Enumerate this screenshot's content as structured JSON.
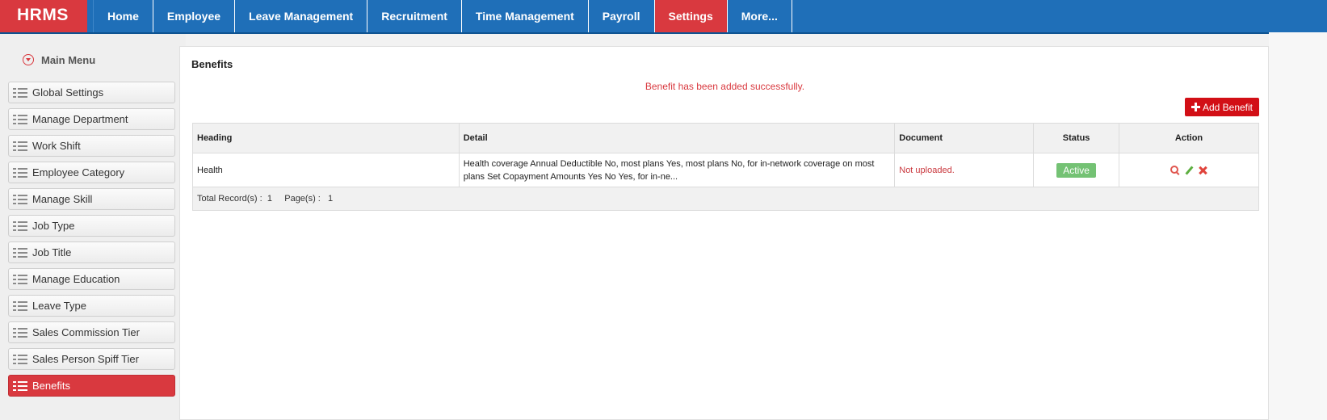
{
  "app": {
    "logo": "HRMS"
  },
  "nav": {
    "items": [
      "Home",
      "Employee",
      "Leave Management",
      "Recruitment",
      "Time Management",
      "Payroll",
      "Settings",
      "More..."
    ],
    "active_index": 6
  },
  "sidebar": {
    "title": "Main Menu",
    "items": [
      "Global Settings",
      "Manage Department",
      "Work Shift",
      "Employee Category",
      "Manage Skill",
      "Job Type",
      "Job Title",
      "Manage Education",
      "Leave Type",
      "Sales Commission Tier",
      "Sales Person Spiff Tier",
      "Benefits"
    ],
    "active_index": 11
  },
  "page": {
    "title": "Benefits",
    "message": "Benefit has been added successfully.",
    "add_button": "Add Benefit"
  },
  "table": {
    "headers": {
      "heading": "Heading",
      "detail": "Detail",
      "document": "Document",
      "status": "Status",
      "action": "Action"
    },
    "rows": [
      {
        "heading": "Health",
        "detail": "Health coverage Annual Deductible No, most plans Yes, most plans No, for in-network coverage on most plans Set Copayment Amounts Yes No Yes, for in-ne...",
        "document": "Not uploaded.",
        "status": "Active"
      }
    ],
    "footer": {
      "records_label": "Total Record(s) :",
      "records": "1",
      "pages_label": "Page(s) :",
      "pages": "1"
    }
  },
  "colors": {
    "nav_blue": "#1f6fb8",
    "accent_red": "#d9393f",
    "status_green": "#5cb85c"
  }
}
